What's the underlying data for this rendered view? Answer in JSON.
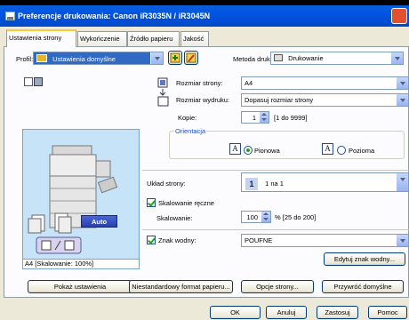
{
  "window": {
    "title": "Preferencje drukowania: Canon iR3035N / iR3045N"
  },
  "tabs": [
    {
      "label": "Ustawienia strony",
      "active": true
    },
    {
      "label": "Wykończenie",
      "active": false
    },
    {
      "label": "Źródło papieru",
      "active": false
    },
    {
      "label": "Jakość",
      "active": false
    }
  ],
  "profile": {
    "label": "Profil:",
    "value": "Ustawienia domyślne"
  },
  "output_method": {
    "label": "Metoda druku:",
    "value": "Drukowanie"
  },
  "page_size": {
    "label": "Rozmiar strony:",
    "value": "A4"
  },
  "output_size": {
    "label": "Rozmiar wydruku:",
    "value": "Dopasuj rozmiar strony"
  },
  "copies": {
    "label": "Kopie:",
    "value": "1",
    "range": "[1 do 9999]"
  },
  "orientation": {
    "label": "Orientacja",
    "portrait": "Pionowa",
    "landscape": "Pozioma",
    "selected": "portrait"
  },
  "layout": {
    "label": "Układ strony:",
    "value": "1 na 1",
    "badge": "1"
  },
  "manual_scaling": {
    "label": "Skalowanie ręczne",
    "checked": true
  },
  "scaling": {
    "label": "Skalowanie:",
    "value": "100",
    "range": "% [25 do 200]"
  },
  "watermark": {
    "label": "Znak wodny:",
    "checked": true,
    "value": "POUFNE",
    "edit_button": "Edytuj znak wodny..."
  },
  "preview": {
    "auto_label": "Auto",
    "caption": "A4 [Skalowanie: 100%]"
  },
  "show_settings_button": "Pokaż ustawienia",
  "footer_buttons": {
    "custom_paper": "Niestandardowy format papieru...",
    "page_options": "Opcje strony...",
    "restore_defaults": "Przywróć domyślne"
  },
  "dialog_buttons": {
    "ok": "OK",
    "cancel": "Anuluj",
    "apply": "Zastosuj",
    "help": "Pomoc"
  },
  "colors": {
    "titlebar": "#0054e3",
    "dialog_bg": "#ece9d8",
    "preview_bg": "#c6e3f7",
    "selection_blue": "#316ac5",
    "auto_button": "#2b3fa8"
  }
}
